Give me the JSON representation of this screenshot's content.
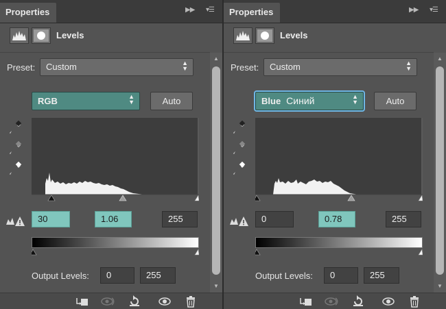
{
  "panels": [
    {
      "tab_title": "Properties",
      "adjustment_title": "Levels",
      "preset_label": "Preset:",
      "preset_value": "Custom",
      "channel_value": "RGB",
      "channel_annotation": "",
      "auto_label": "Auto",
      "input_black": "30",
      "input_gamma": "1.06",
      "input_white": "255",
      "output_label": "Output Levels:",
      "output_black": "0",
      "output_white": "255",
      "input_gamma_position": 0.53
    },
    {
      "tab_title": "Properties",
      "adjustment_title": "Levels",
      "preset_label": "Preset:",
      "preset_value": "Custom",
      "channel_value": "Blue",
      "channel_annotation": "Синий",
      "auto_label": "Auto",
      "input_black": "0",
      "input_gamma": "0.78",
      "input_white": "255",
      "output_label": "Output Levels:",
      "output_black": "0",
      "output_white": "255",
      "input_gamma_position": 0.57
    }
  ],
  "icons": {
    "panel_collapse": "double-chevron-right-icon",
    "panel_menu": "panel-menu-icon",
    "levels": "levels-histogram-icon",
    "mask": "layer-mask-icon",
    "eyedroppers": [
      "black-point-eyedropper-icon",
      "gray-point-eyedropper-icon",
      "white-point-eyedropper-icon"
    ],
    "clipping_warning": "clipping-warning-icon",
    "footer": [
      "clip-to-layer-icon",
      "view-previous-state-icon",
      "reset-icon",
      "visibility-eye-icon",
      "trash-icon"
    ]
  },
  "colors": {
    "panel_bg": "#535353",
    "channel_accent": "#4f8a82",
    "active_field": "#80c6bd",
    "focus_ring": "#6fb7e5"
  }
}
